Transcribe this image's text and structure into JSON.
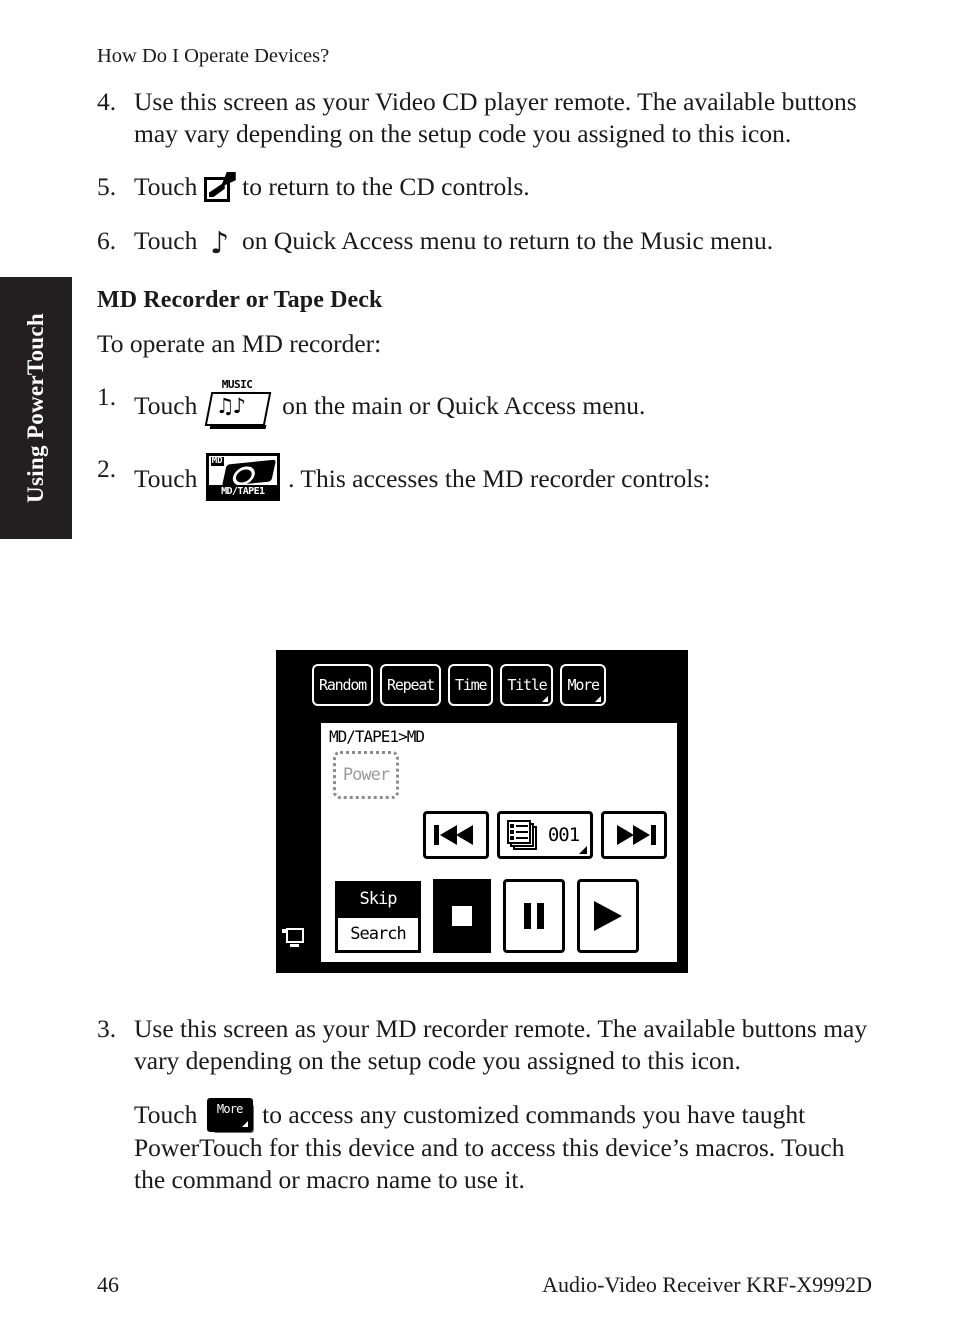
{
  "running_head": "How Do I Operate Devices?",
  "side_tab": {
    "label": "Using PowerTouch"
  },
  "steps_top": [
    {
      "num": "4.",
      "text": "Use this screen as your Video CD player remote. The available buttons may vary depending on the setup code you assigned to this icon."
    }
  ],
  "step5": {
    "num": "5.",
    "before": "Touch",
    "icon": "edit-pencil-icon",
    "after": "to return to the CD controls."
  },
  "step6": {
    "num": "6.",
    "before": "Touch",
    "icon": "music-note-icon",
    "glyph": "♪",
    "after": "on Quick Access menu to return to the Music menu."
  },
  "section": {
    "heading": "MD Recorder or Tape Deck",
    "intro": "To operate an MD recorder:"
  },
  "step1": {
    "num": "1.",
    "before": "Touch",
    "icon": "music-menu-icon",
    "icon_caption": "MUSIC",
    "icon_notes": "♫♪",
    "after": "on the main or Quick Access menu."
  },
  "step2": {
    "num": "2.",
    "before": "Touch",
    "icon": "md-tape1-icon",
    "icon_top_label": "MD",
    "icon_bottom_label": "MD/TAPE1",
    "after": ". This accesses the MD recorder controls:"
  },
  "step3": {
    "num": "3.",
    "text": "Use this screen as your MD recorder remote. The available buttons may vary depending on the setup code you assigned to this icon."
  },
  "more_para": {
    "before": "Touch",
    "icon": "more-button-icon",
    "icon_label": "More",
    "after": "to access any customized commands you have taught PowerTouch for this device and to access this device’s macros. Touch the command or macro name to use it."
  },
  "lcd": {
    "screen_icon": "display-device-icon",
    "top_buttons": [
      {
        "label": "Random",
        "has_corner": false
      },
      {
        "label": "Repeat",
        "has_corner": false
      },
      {
        "label": "Time",
        "has_corner": false
      },
      {
        "label": "Title",
        "has_corner": true
      },
      {
        "label": "More",
        "has_corner": true
      }
    ],
    "panel_title": "MD/TAPE1>MD",
    "power_button": "Power",
    "prev_button": "previous-track-icon",
    "next_button": "next-track-icon",
    "track_number": "001",
    "track_list_icon": "track-list-icon",
    "skip_button": "Skip",
    "search_button": "Search",
    "stop_button": "stop-icon",
    "pause_button": "pause-icon",
    "play_button": "play-icon"
  },
  "footer": {
    "page_number": "46",
    "product": "Audio-Video Receiver KRF-X9992D"
  }
}
